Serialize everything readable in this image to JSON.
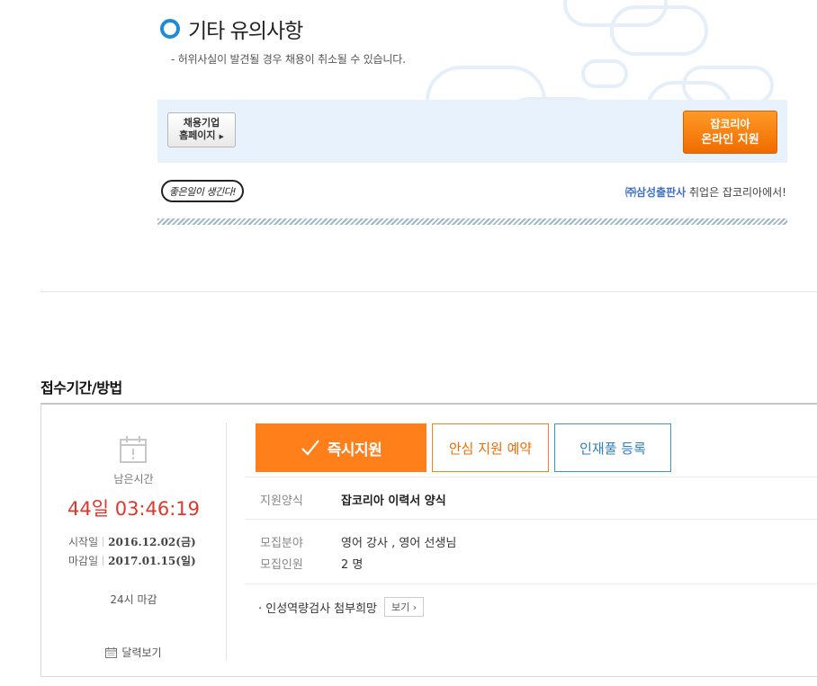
{
  "notice": {
    "title": "기타 유의사항",
    "text": "- 허위사실이 발견될 경우 채용이 취소될 수 있습니다."
  },
  "apply_bar": {
    "homepage_button": {
      "line1": "채용기업",
      "line2": "홈페이지",
      "arrow": "▶"
    },
    "online_apply_button": {
      "line1": "잡코리아",
      "line2": "온라인 지원"
    }
  },
  "footer_strip": {
    "sticker_text": "좋은일이 생긴다!",
    "company": "㈜삼성출판사",
    "slogan_suffix": " 취업은 잡코리아에서!"
  },
  "section": {
    "title": "접수기간/방법"
  },
  "period": {
    "remaining_label": "남은시간",
    "countdown_days": "44일",
    "countdown_time": "03:46:19",
    "start_label": "시작일",
    "start_date": "2016.12.02(금)",
    "end_label": "마감일",
    "end_date": "2017.01.15(일)",
    "deadline_note": "24시 마감",
    "calendar_link": "달력보기"
  },
  "actions": {
    "apply_now": "즉시지원",
    "reserve": "안심 지원 예약",
    "talent_pool": "인재풀 등록"
  },
  "details": {
    "form_label": "지원양식",
    "form_value": "잡코리아 이력서 양식",
    "field_label": "모집분야",
    "field_value": "영어 강사 , 영어 선생님",
    "count_label": "모집인원",
    "count_value": "2 명",
    "personality_text": "· 인성역량검사 첨부희망",
    "view_button": "보기",
    "view_arrow": "›"
  },
  "colors": {
    "accent_orange": "#ff7f1a",
    "countdown_red": "#e0362c",
    "ring_blue": "#1e8bd8",
    "talent_blue": "#3f93d0"
  }
}
